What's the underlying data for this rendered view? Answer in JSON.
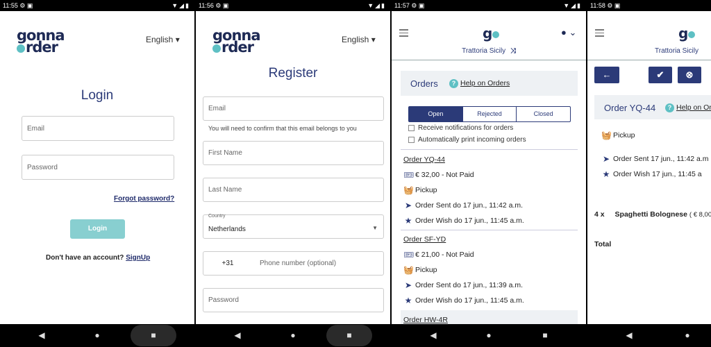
{
  "status_times": [
    "11:55",
    "11:56",
    "11:57",
    "11:58"
  ],
  "status_icons": "▼◢▮",
  "logo": {
    "line1": "gonna",
    "line2": "rder"
  },
  "lang": "English ▾",
  "nav": {
    "back": "◀",
    "home": "●",
    "recent": "■"
  },
  "login": {
    "title": "Login",
    "email_placeholder": "Email",
    "password_placeholder": "Password",
    "forgot": "Forgot password?",
    "button": "Login",
    "no_account": "Don't have an account?",
    "signup": "SignUp"
  },
  "register": {
    "title": "Register",
    "email_placeholder": "Email",
    "email_hint": "You will need to confirm that this email belongs to you",
    "first_name": "First Name",
    "last_name": "Last Name",
    "country_label": "Country",
    "country_value": "Netherlands",
    "dial_code": "+31",
    "phone_placeholder": "Phone number (optional)",
    "password_placeholder": "Password"
  },
  "orders": {
    "restaurant": "Trattoria Sicily",
    "section_title": "Orders",
    "help": "Help on Orders",
    "tabs": [
      "Open",
      "Rejected",
      "Closed"
    ],
    "notify": "Receive notifications for orders",
    "autoprint": "Automatically print incoming orders",
    "list": [
      {
        "id": "Order YQ-44",
        "price": "€ 32,00 - Not Paid",
        "type": "Pickup",
        "sent": "Order Sent do 17 jun., 11:42 a.m.",
        "wish": "Order Wish do 17 jun., 11:45 a.m."
      },
      {
        "id": "Order SF-YD",
        "price": "€ 21,00 - Not Paid",
        "type": "Pickup",
        "sent": "Order Sent do 17 jun., 11:39 a.m.",
        "wish": "Order Wish do 17 jun., 11:45 a.m."
      },
      {
        "id": "Order HW-4R"
      }
    ]
  },
  "detail": {
    "restaurant": "Trattoria Sicily",
    "title": "Order YQ-44",
    "help": "Help on Or",
    "type": "Pickup",
    "sent": "Order Sent 17 jun., 11:42 a.m",
    "wish": "Order Wish 17 jun., 11:45 a",
    "qty": "4 x",
    "item": "Spaghetti Bolognese",
    "item_price": "( € 8,00",
    "total": "Total"
  }
}
